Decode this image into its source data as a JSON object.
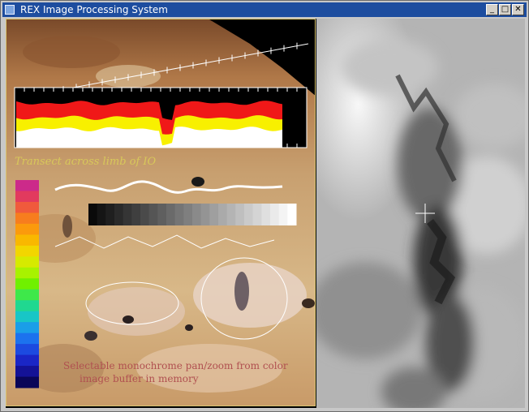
{
  "window": {
    "title": "REX Image Processing System",
    "buttons": {
      "minimize": "_",
      "maximize": "□",
      "close": "✕"
    }
  },
  "left_image": {
    "transect_caption": "Transect across limb of IO",
    "note_line1": "Selectable monochrome pan/zoom from color",
    "note_line2": "image buffer in memory",
    "caption_color": "#d8c85a",
    "note_color": "#b05050"
  },
  "color_scale": [
    "#cc2a8a",
    "#e23a5e",
    "#f05a3c",
    "#f77d1e",
    "#fb9a0c",
    "#f9b800",
    "#f2d600",
    "#d6ea00",
    "#a8f200",
    "#70f000",
    "#3ee84a",
    "#20d890",
    "#18c6c6",
    "#1a9ee8",
    "#1c72ee",
    "#1c4ae0",
    "#1a26c6",
    "#141296",
    "#0a0658"
  ],
  "gray_scale_steps": 24,
  "icons": {
    "app": "rex-app-icon",
    "crosshair": "crosshair-icon"
  }
}
